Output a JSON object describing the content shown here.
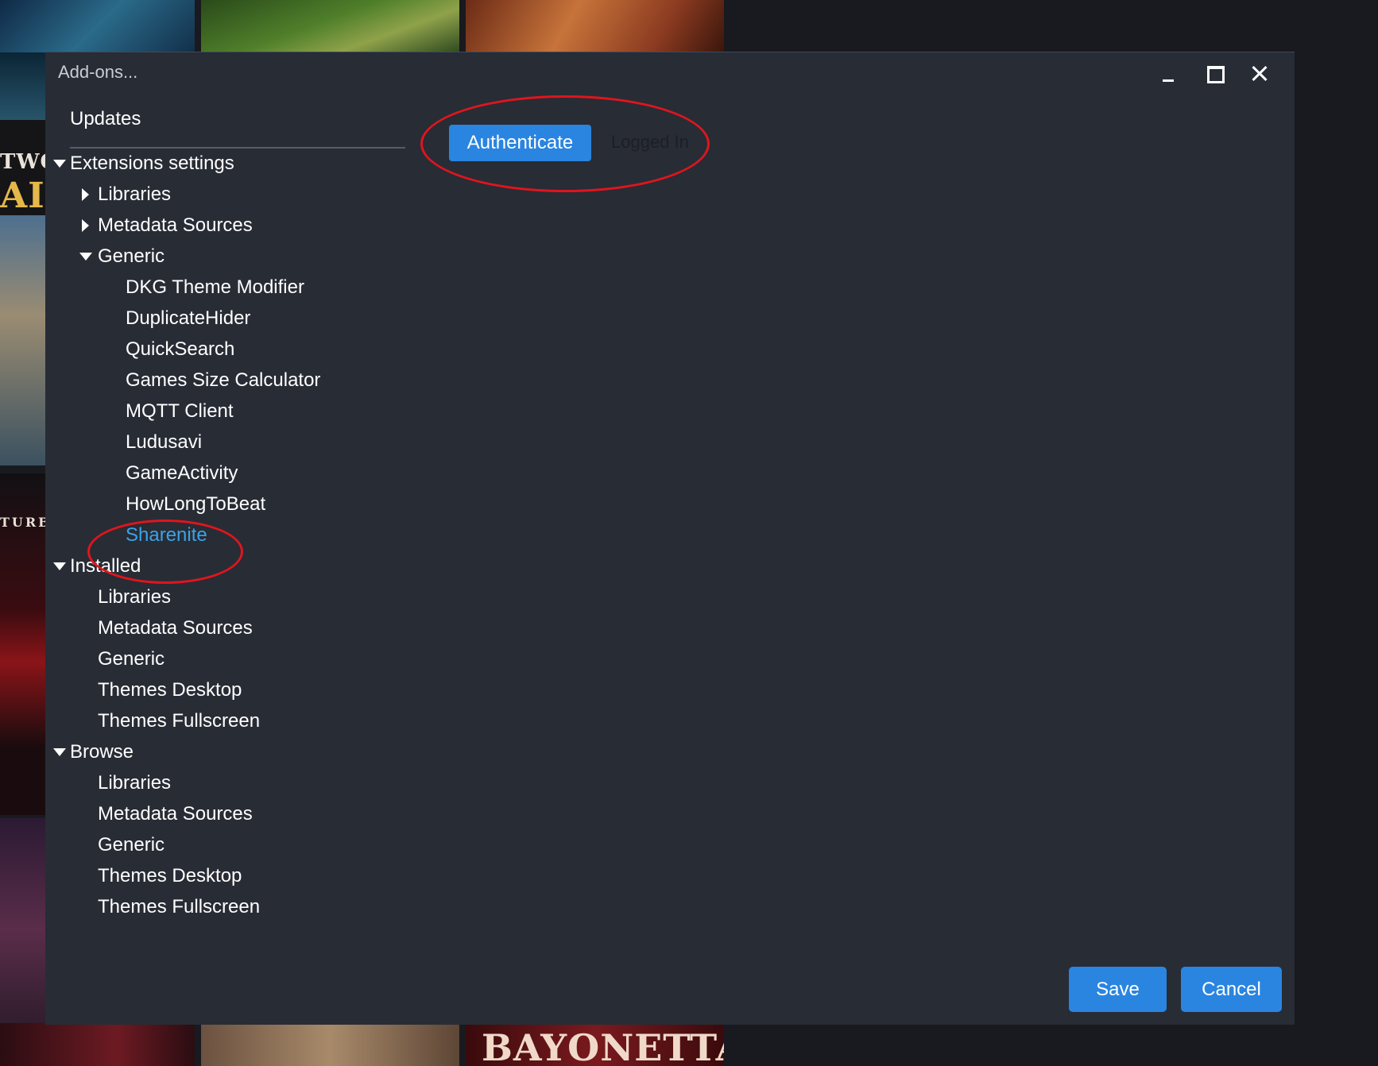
{
  "window": {
    "title": "Add-ons..."
  },
  "background": {
    "cover_text_top": "TWO",
    "cover_text_side": "AI",
    "cover_text_mid": "TURB",
    "cover_text_bottom": "BAYONETTA"
  },
  "sidebar": {
    "updates_label": "Updates",
    "tree": [
      {
        "label": "Extensions settings",
        "level": 0,
        "expander": "expanded"
      },
      {
        "label": "Libraries",
        "level": 1,
        "expander": "collapsed"
      },
      {
        "label": "Metadata Sources",
        "level": 1,
        "expander": "collapsed"
      },
      {
        "label": "Generic",
        "level": 1,
        "expander": "expanded"
      },
      {
        "label": "DKG Theme Modifier",
        "level": 2,
        "expander": "none"
      },
      {
        "label": "DuplicateHider",
        "level": 2,
        "expander": "none"
      },
      {
        "label": "QuickSearch",
        "level": 2,
        "expander": "none"
      },
      {
        "label": "Games Size Calculator",
        "level": 2,
        "expander": "none"
      },
      {
        "label": "MQTT Client",
        "level": 2,
        "expander": "none"
      },
      {
        "label": "Ludusavi",
        "level": 2,
        "expander": "none"
      },
      {
        "label": "GameActivity",
        "level": 2,
        "expander": "none"
      },
      {
        "label": "HowLongToBeat",
        "level": 2,
        "expander": "none"
      },
      {
        "label": "Sharenite",
        "level": 2,
        "expander": "none",
        "selected": true
      },
      {
        "label": "Installed",
        "level": 0,
        "expander": "expanded"
      },
      {
        "label": "Libraries",
        "level": 1,
        "expander": "none"
      },
      {
        "label": "Metadata Sources",
        "level": 1,
        "expander": "none"
      },
      {
        "label": "Generic",
        "level": 1,
        "expander": "none"
      },
      {
        "label": "Themes Desktop",
        "level": 1,
        "expander": "none"
      },
      {
        "label": "Themes Fullscreen",
        "level": 1,
        "expander": "none"
      },
      {
        "label": "Browse",
        "level": 0,
        "expander": "expanded"
      },
      {
        "label": "Libraries",
        "level": 1,
        "expander": "none"
      },
      {
        "label": "Metadata Sources",
        "level": 1,
        "expander": "none"
      },
      {
        "label": "Generic",
        "level": 1,
        "expander": "none"
      },
      {
        "label": "Themes Desktop",
        "level": 1,
        "expander": "none"
      },
      {
        "label": "Themes Fullscreen",
        "level": 1,
        "expander": "none"
      }
    ]
  },
  "content": {
    "authenticate_label": "Authenticate",
    "status_label": "Logged In"
  },
  "footer": {
    "save_label": "Save",
    "cancel_label": "Cancel"
  },
  "colors": {
    "window_bg": "#282c35",
    "accent": "#2a85e0",
    "selected_text": "#3aa3e8",
    "annotation": "#e0151d"
  }
}
